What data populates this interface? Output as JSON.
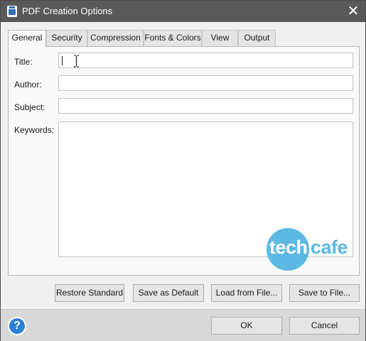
{
  "window": {
    "title": "PDF Creation Options",
    "app_icon": "pdf-app-icon",
    "close_glyph": "✕"
  },
  "tabs": [
    {
      "label": "General",
      "active": true
    },
    {
      "label": "Security",
      "active": false
    },
    {
      "label": "Compression",
      "active": false
    },
    {
      "label": "Fonts & Colors",
      "active": false
    },
    {
      "label": "View",
      "active": false
    },
    {
      "label": "Output",
      "active": false
    }
  ],
  "general": {
    "title_label": "Title:",
    "title_value": "",
    "author_label": "Author:",
    "author_value": "",
    "subject_label": "Subject:",
    "subject_value": "",
    "keywords_label": "Keywords:",
    "keywords_value": ""
  },
  "watermark": {
    "part1": "tech",
    "part2": "cafe",
    "color": "#5cb9e3"
  },
  "buttons": {
    "restore": "Restore Standard",
    "save_default": "Save as Default",
    "load": "Load from File...",
    "save_file": "Save to File...",
    "ok": "OK",
    "cancel": "Cancel"
  },
  "footer": {
    "help_glyph": "?",
    "help_icon": "help-icon"
  },
  "colors": {
    "titlebar": "#595959",
    "accent": "#2a7fd4"
  }
}
